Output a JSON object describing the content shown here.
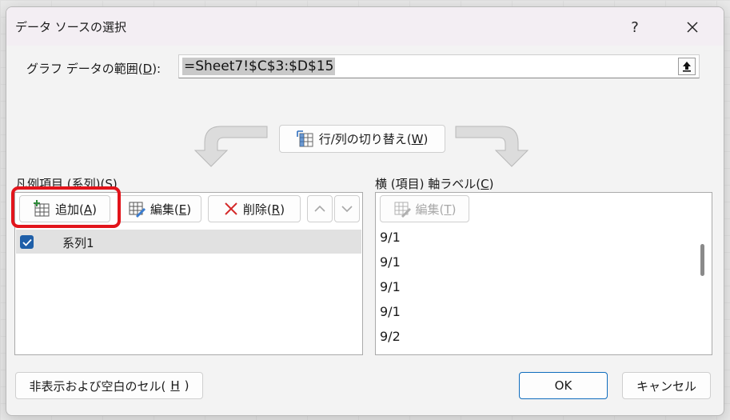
{
  "window": {
    "title": "データ ソースの選択",
    "help_label": "?",
    "close_label": "✕"
  },
  "range": {
    "label_prefix": "グラフ データの範囲(",
    "label_key": "D",
    "label_suffix": "):",
    "value": "=Sheet7!$C$3:$D$15"
  },
  "switch_button": {
    "label_prefix": "行/列の切り替え(",
    "label_key": "W",
    "label_suffix": ")"
  },
  "legend": {
    "label_prefix": "凡例項目 (系列)(",
    "label_key": "S",
    "label_suffix": ")",
    "add": {
      "prefix": "追加(",
      "key": "A",
      "suffix": ")"
    },
    "edit": {
      "prefix": "編集(",
      "key": "E",
      "suffix": ")"
    },
    "delete": {
      "prefix": "削除(",
      "key": "R",
      "suffix": ")"
    },
    "series": [
      {
        "name": "系列1",
        "checked": true
      }
    ]
  },
  "axis": {
    "label_prefix": "横 (項目) 軸ラベル(",
    "label_key": "C",
    "label_suffix": ")",
    "edit": {
      "prefix": "編集(",
      "key": "T",
      "suffix": ")"
    },
    "items": [
      "9/1",
      "9/1",
      "9/1",
      "9/1",
      "9/2"
    ]
  },
  "footer": {
    "hidden_cells": {
      "prefix": "非表示および空白のセル(",
      "key": "H",
      "suffix": ")"
    },
    "ok": "OK",
    "cancel": "キャンセル"
  },
  "colors": {
    "highlight": "#e2141b",
    "checkbox": "#1f5fa8",
    "ok_border": "#0f6cbd"
  }
}
